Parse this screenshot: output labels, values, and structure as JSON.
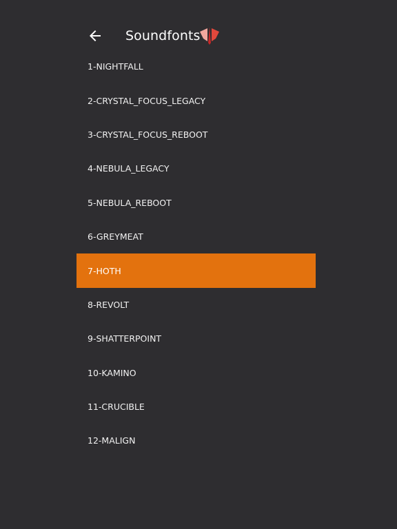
{
  "header": {
    "title": "Soundfonts",
    "back_icon": "arrow-left-icon",
    "logo_icon": "red-crest-logo-icon"
  },
  "colors": {
    "background": "#2e2d30",
    "accent": "#e3720e",
    "logo_red": "#e2483c"
  },
  "soundfonts": [
    {
      "label": "1-NIGHTFALL",
      "selected": false
    },
    {
      "label": "2-CRYSTAL_FOCUS_LEGACY",
      "selected": false
    },
    {
      "label": "3-CRYSTAL_FOCUS_REBOOT",
      "selected": false
    },
    {
      "label": "4-NEBULA_LEGACY",
      "selected": false
    },
    {
      "label": "5-NEBULA_REBOOT",
      "selected": false
    },
    {
      "label": "6-GREYMEAT",
      "selected": false
    },
    {
      "label": "7-HOTH",
      "selected": true
    },
    {
      "label": "8-REVOLT",
      "selected": false
    },
    {
      "label": "9-SHATTERPOINT",
      "selected": false
    },
    {
      "label": "10-KAMINO",
      "selected": false
    },
    {
      "label": "11-CRUCIBLE",
      "selected": false
    },
    {
      "label": "12-MALIGN",
      "selected": false
    }
  ]
}
